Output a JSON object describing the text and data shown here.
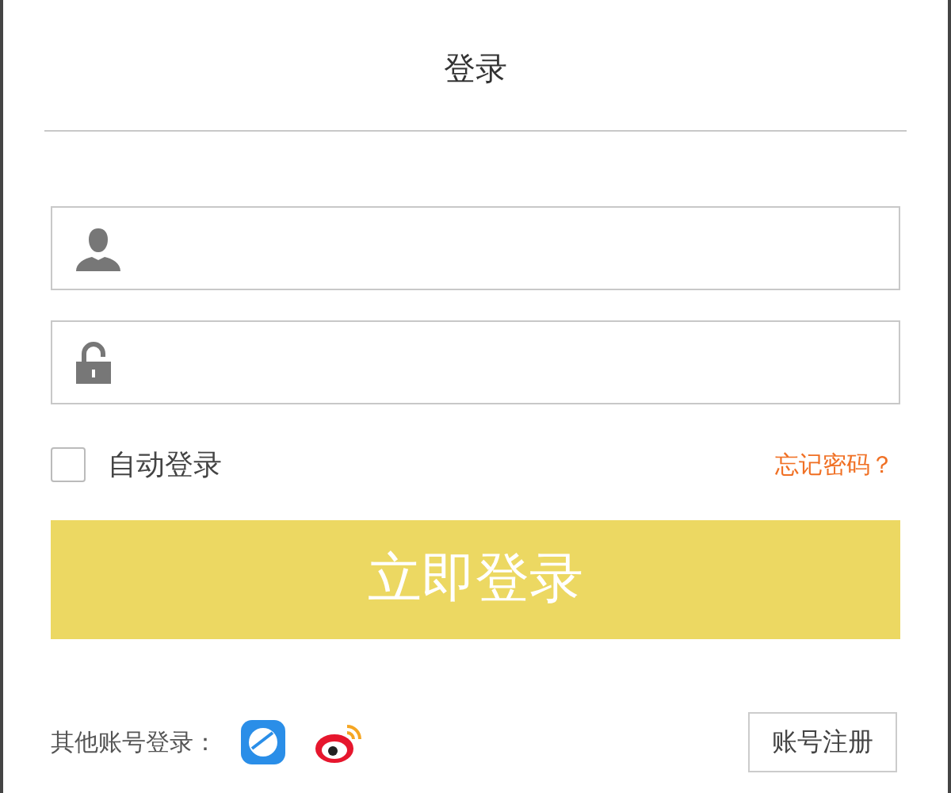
{
  "title": "登录",
  "fields": [
    {
      "kind": "user"
    },
    {
      "kind": "password"
    }
  ],
  "auto_login": {
    "label": "自动登录",
    "checked": false
  },
  "forgot_link": "忘记密码？",
  "submit": "立即登录",
  "other_login": {
    "label": "其他账号登录：",
    "providers": [
      {
        "kind": "bubble"
      },
      {
        "kind": "weibo"
      }
    ]
  },
  "register": "账号注册"
}
